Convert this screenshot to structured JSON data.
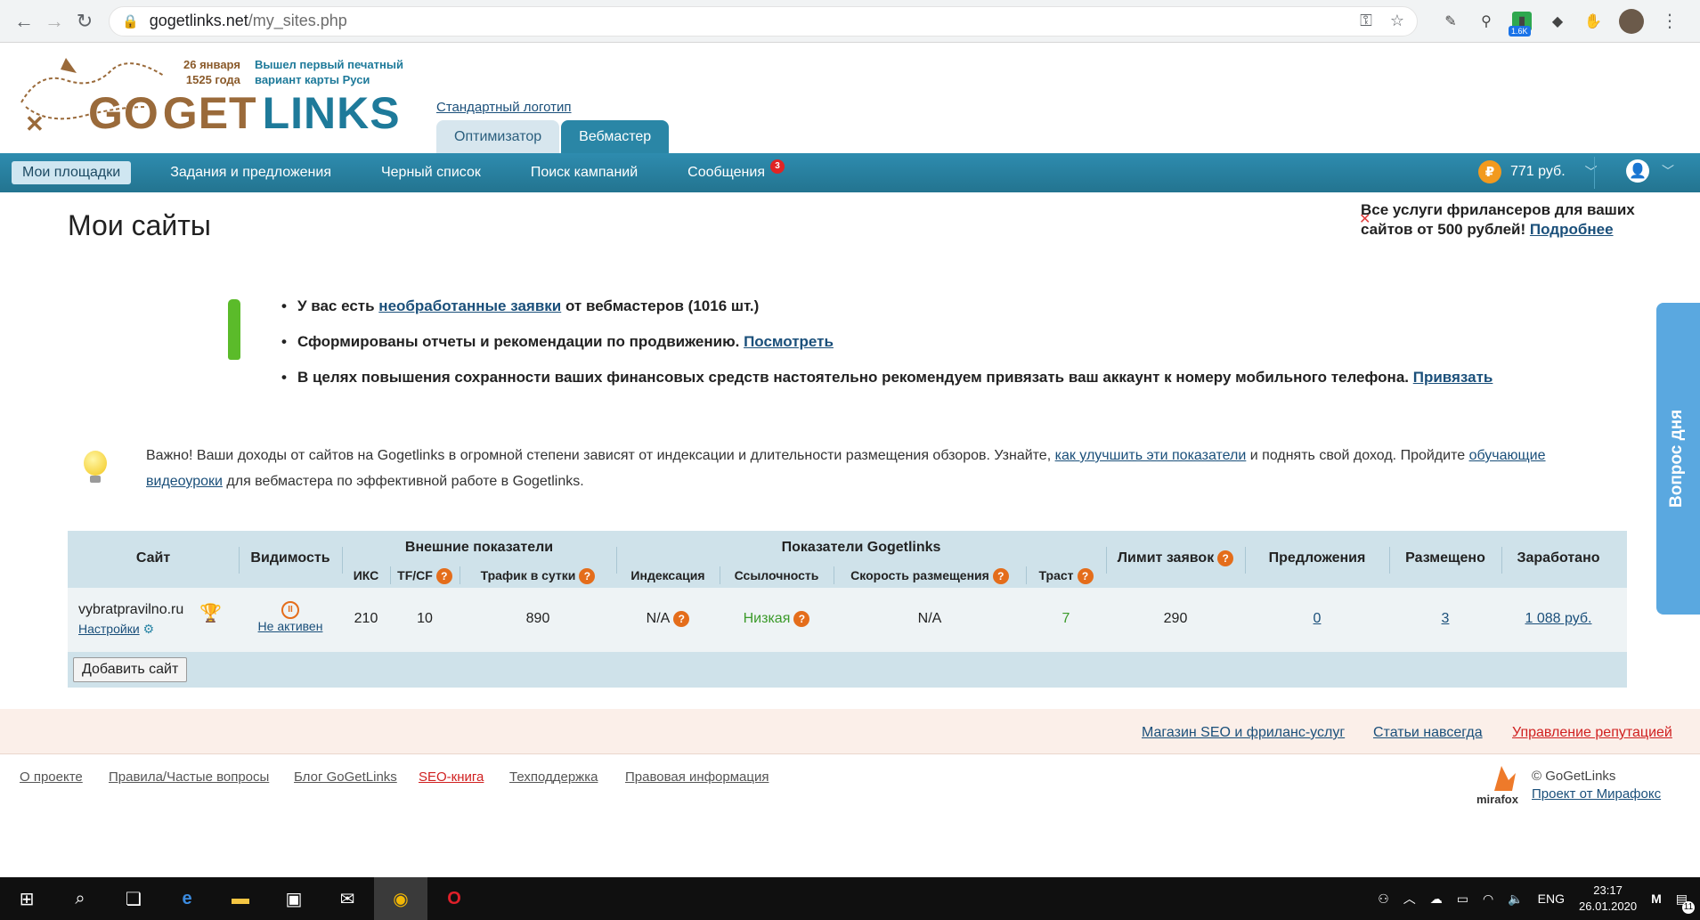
{
  "browser": {
    "url_host": "gogetlinks.net",
    "url_path": "/my_sites.php",
    "ext_badge": "1.6K"
  },
  "logo": {
    "date_line1": "26 января",
    "date_line2": "1525 года",
    "note_line1": "Вышел первый печатный",
    "note_line2": "вариант карты Руси",
    "part_go": "GO",
    "part_get": "GET",
    "part_links": "LINKS"
  },
  "header": {
    "std_logo_link": "Стандартный логотип",
    "role_tabs": [
      {
        "label": "Оптимизатор",
        "active": false
      },
      {
        "label": "Вебмастер",
        "active": true
      }
    ]
  },
  "nav": {
    "items": [
      {
        "label": "Мои площадки",
        "active": true
      },
      {
        "label": "Задания и предложения"
      },
      {
        "label": "Черный список"
      },
      {
        "label": "Поиск кампаний"
      },
      {
        "label": "Сообщения",
        "badge": "3"
      }
    ],
    "balance": "771 руб.",
    "ruble_symbol": "₽"
  },
  "page": {
    "title": "Мои сайты",
    "promo_text": "Все услуги фрилансеров для ваших сайтов от 500 рублей!",
    "promo_link": "Подробнее",
    "alerts": [
      {
        "pre": "У вас есть ",
        "link": "необработанные заявки",
        "post": " от вебмастеров (1016 шт.)"
      },
      {
        "pre": "Сформированы отчеты и рекомендации по продвижению. ",
        "link": "Посмотреть",
        "post": ""
      },
      {
        "pre": "В целях повышения сохранности ваших финансовых средств настоятельно рекомендуем привязать ваш аккаунт к номеру мобильного телефона. ",
        "link": "Привязать",
        "post": ""
      }
    ],
    "tip_pre": "Важно! Ваши доходы от сайтов на Gogetlinks в огромной степени зависят от индексации и длительности размещения обзоров. Узнайте, ",
    "tip_link1": "как улучшить эти показатели",
    "tip_mid": " и поднять свой доход. Пройдите ",
    "tip_link2": "обучающие видеоуроки",
    "tip_post": " для вебмастера по эффективной работе в Gogetlinks."
  },
  "table": {
    "headers": {
      "site": "Сайт",
      "visibility": "Видимость",
      "external": "Внешние показатели",
      "gogetlinks": "Показатели Gogetlinks",
      "limit": "Лимит заявок",
      "offers": "Предложения",
      "placed": "Размещено",
      "earned": "Заработано",
      "iks": "ИКС",
      "tfcf": "TF/CF",
      "traffic": "Трафик в сутки",
      "indexing": "Индексация",
      "linkability": "Ссылочность",
      "speed": "Скорость размещения",
      "trust": "Траст"
    },
    "row": {
      "site": "vybratpravilno.ru",
      "settings": "Настройки",
      "status": "Не активен",
      "iks": "210",
      "tfcf": "10",
      "traffic": "890",
      "indexing": "N/A",
      "linkability": "Низкая",
      "speed": "N/A",
      "trust": "7",
      "limit": "290",
      "offers": "0",
      "placed": "3",
      "earned": "1 088 руб."
    },
    "add_button": "Добавить сайт"
  },
  "side_widget": "Вопрос дня",
  "footer": {
    "top_links": [
      "Магазин SEO и фриланс-услуг",
      "Статьи навсегда",
      "Управление репутацией"
    ],
    "links": [
      "О проекте",
      "Правила/Частые вопросы",
      "Блог GoGetLinks",
      "SEO-книга",
      "Техподдержка",
      "Правовая информация"
    ],
    "copyright": "© GoGetLinks",
    "mirafox_link": "Проект от Мирафокс",
    "mirafox_logo": "mirafox"
  },
  "taskbar": {
    "lang": "ENG",
    "time": "23:17",
    "date": "26.01.2020",
    "notif_count": "11"
  },
  "colors": {
    "nav_bg": "#237490",
    "accent_orange": "#e46d1b",
    "green_ok": "#3b9a2a",
    "red_link": "#d02020"
  }
}
